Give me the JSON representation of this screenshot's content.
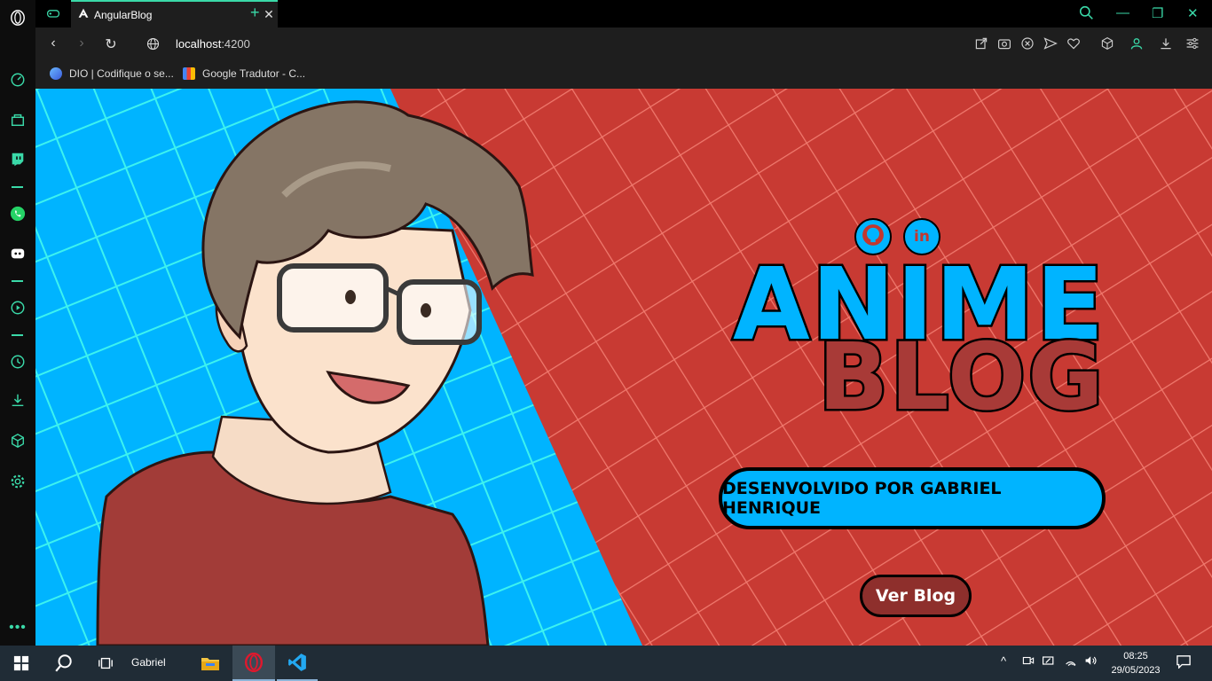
{
  "browser": {
    "tab": {
      "title": "AngularBlog"
    },
    "address": {
      "host": "localhost",
      "port": ":4200"
    },
    "bookmarks": [
      {
        "label": "DIO | Codifique o se..."
      },
      {
        "label": "Google Tradutor - C..."
      }
    ]
  },
  "hero": {
    "title_line1": "ANIME",
    "title_line2": "BLOG",
    "developer_label": "DESENVOLVIDO POR GABRIEL HENRIQUE",
    "cta_label": "Ver Blog",
    "linkedin_glyph": "in"
  },
  "taskbar": {
    "user": "Gabriel",
    "time": "08:25",
    "date": "29/05/2023"
  },
  "colors": {
    "accent": "#3ad9a8",
    "hero_blue": "#00b4ff",
    "hero_red": "#c83a33",
    "button_red": "#8e2f2c"
  },
  "icons": [
    "opera-logo-icon",
    "speed-dial-icon",
    "shopping-icon",
    "twitch-icon",
    "whatsapp-icon",
    "discord-icon",
    "player-icon",
    "history-icon",
    "downloads-icon",
    "extensions-icon",
    "settings-icon",
    "github-icon",
    "linkedin-icon",
    "windows-start-icon",
    "search-icon",
    "task-view-icon",
    "file-explorer-icon",
    "opera-taskbar-icon",
    "vscode-icon"
  ]
}
